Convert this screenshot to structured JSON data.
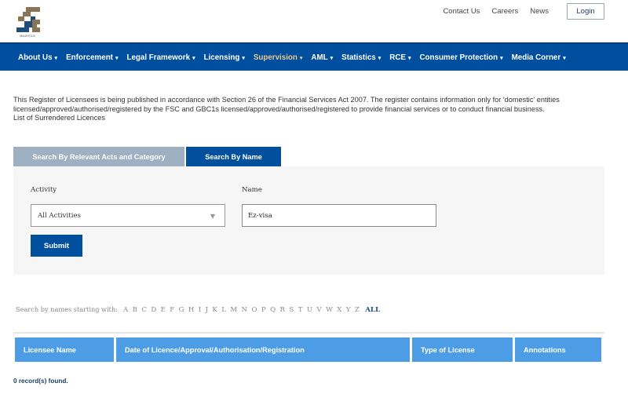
{
  "header": {
    "logo_caption": "MAURITIUS",
    "top_links": [
      "Contact Us",
      "Careers",
      "News"
    ],
    "login_label": "Login"
  },
  "nav": {
    "items": [
      {
        "label": "About Us",
        "active": false
      },
      {
        "label": "Enforcement",
        "active": false
      },
      {
        "label": "Legal Framework",
        "active": false
      },
      {
        "label": "Licensing",
        "active": false
      },
      {
        "label": "Supervision",
        "active": true
      },
      {
        "label": "AML",
        "active": false
      },
      {
        "label": "Statistics",
        "active": false
      },
      {
        "label": "RCE",
        "active": false
      },
      {
        "label": "Consumer Protection",
        "active": false
      },
      {
        "label": "Media Corner",
        "active": false
      }
    ],
    "caret": "▼"
  },
  "intro": {
    "text": "This Register of Licensees is being published in accordance with Section 26 of the Financial Services Act 2007. The register contains information only for 'domestic' entities licensed/approved/authorised/registered by the FSC and GBC1s licensed/approved/authorised/registered to provide financial services or to conduct financial business.",
    "link": "List of Surrendered Licences"
  },
  "tabs": {
    "tab1": "Search By Relevant Acts and Category",
    "tab2": "Search By Name"
  },
  "form": {
    "activity_label": "Activity",
    "activity_value": "All Activities",
    "name_label": "Name",
    "name_value": "Ez-visa",
    "submit_label": "Submit"
  },
  "alpha": {
    "lead": "Search by names starting with:",
    "letters": [
      "A",
      "B",
      "C",
      "D",
      "E",
      "F",
      "G",
      "H",
      "I",
      "J",
      "K",
      "L",
      "M",
      "N",
      "O",
      "P",
      "Q",
      "R",
      "S",
      "T",
      "U",
      "V",
      "W",
      "X",
      "Y",
      "Z"
    ],
    "all": "ALL"
  },
  "table": {
    "headers": [
      "Licensee Name",
      "Date of Licence/Approval/Authorisation/Registration",
      "Type of License",
      "Annotations"
    ]
  },
  "records_text": "0 record(s) found.",
  "colors": {
    "nav_bg": "#004f9e",
    "active_nav": "#e8c98e",
    "table_header": "#4d9de6"
  }
}
